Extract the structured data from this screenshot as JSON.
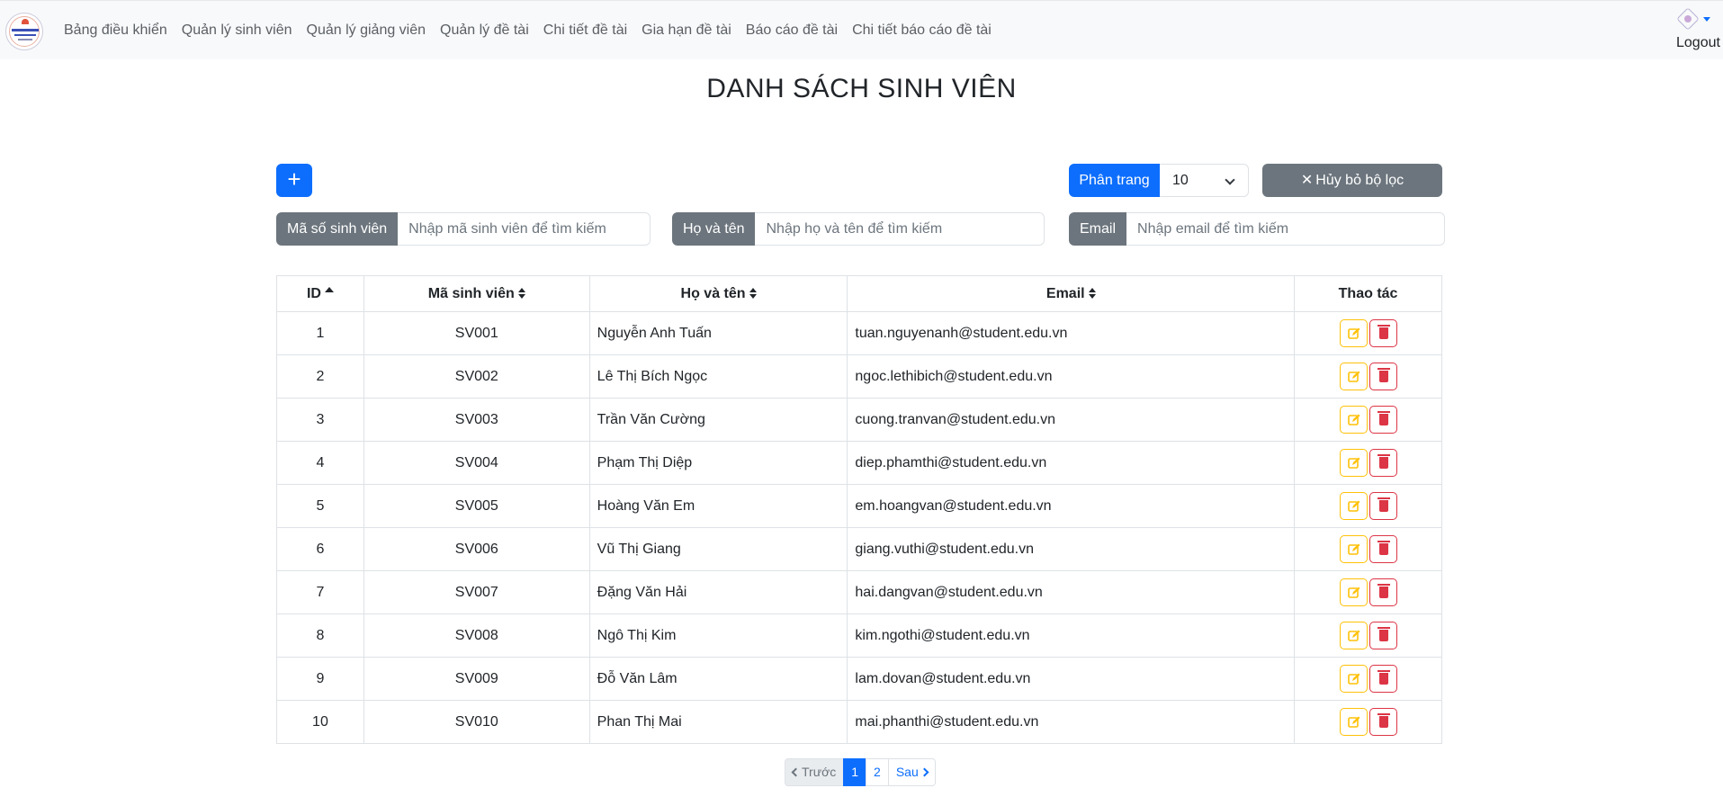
{
  "navbar": {
    "links": [
      "Bảng điều khiển",
      "Quản lý sinh viên",
      "Quản lý giảng viên",
      "Quản lý đề tài",
      "Chi tiết đề tài",
      "Gia hạn đề tài",
      "Báo cáo đề tài",
      "Chi tiết báo cáo đề tài"
    ],
    "logout_label": "Logout"
  },
  "page": {
    "title": "DANH SÁCH SINH VIÊN"
  },
  "toolbar": {
    "add_label": "+",
    "page_size_label": "Phân trang",
    "page_size_value": "10",
    "clear_filter_label": "Hủy bỏ bộ lọc"
  },
  "filters": {
    "code_label": "Mã số sinh viên",
    "code_placeholder": "Nhập mã sinh viên để tìm kiếm",
    "name_label": "Họ và tên",
    "name_placeholder": "Nhập họ và tên để tìm kiếm",
    "email_label": "Email",
    "email_placeholder": "Nhập email để tìm kiếm"
  },
  "table": {
    "headers": [
      "ID",
      "Mã sinh viên",
      "Họ và tên",
      "Email",
      "Thao tác"
    ],
    "rows": [
      [
        "1",
        "SV001",
        "Nguyễn Anh Tuấn",
        "tuan.nguyenanh@student.edu.vn"
      ],
      [
        "2",
        "SV002",
        "Lê Thị Bích Ngọc",
        "ngoc.lethibich@student.edu.vn"
      ],
      [
        "3",
        "SV003",
        "Trần Văn Cường",
        "cuong.tranvan@student.edu.vn"
      ],
      [
        "4",
        "SV004",
        "Phạm Thị Diệp",
        "diep.phamthi@student.edu.vn"
      ],
      [
        "5",
        "SV005",
        "Hoàng Văn Em",
        "em.hoangvan@student.edu.vn"
      ],
      [
        "6",
        "SV006",
        "Vũ Thị Giang",
        "giang.vuthi@student.edu.vn"
      ],
      [
        "7",
        "SV007",
        "Đặng Văn Hải",
        "hai.dangvan@student.edu.vn"
      ],
      [
        "8",
        "SV008",
        "Ngô Thị Kim",
        "kim.ngothi@student.edu.vn"
      ],
      [
        "9",
        "SV009",
        "Đỗ Văn Lâm",
        "lam.dovan@student.edu.vn"
      ],
      [
        "10",
        "SV010",
        "Phan Thị Mai",
        "mai.phanthi@student.edu.vn"
      ]
    ]
  },
  "pagination": {
    "prev_label": "Trước",
    "pages": [
      "1",
      "2"
    ],
    "active_page": "1",
    "next_label": "Sau"
  },
  "colors": {
    "primary": "#0d6efd",
    "secondary": "#6c757d",
    "warning": "#ffc107",
    "danger": "#dc3545"
  }
}
